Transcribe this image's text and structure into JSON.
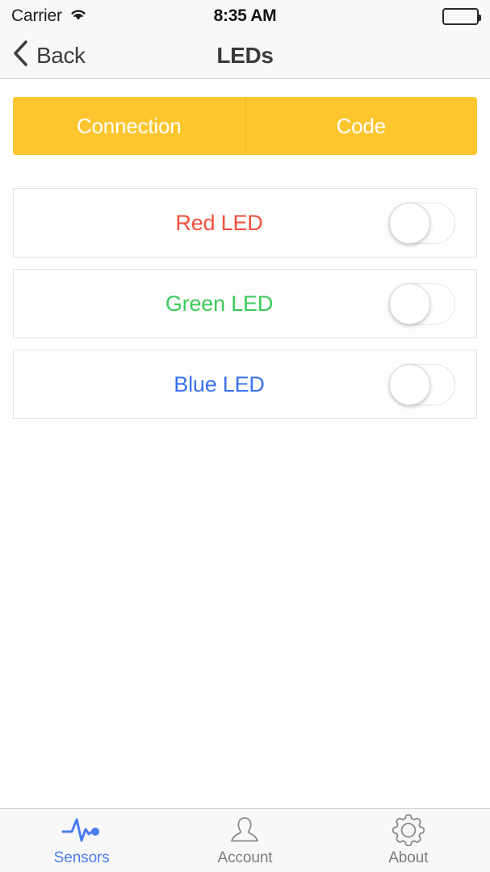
{
  "status_bar": {
    "carrier": "Carrier",
    "wifi_icon": "wifi-icon",
    "time": "8:35 AM",
    "battery_icon": "battery-full-icon"
  },
  "nav_bar": {
    "back_icon": "chevron-left-icon",
    "back_label": "Back",
    "title": "LEDs"
  },
  "segmented_control": {
    "segments": [
      {
        "label": "Connection",
        "selected": true
      },
      {
        "label": "Code",
        "selected": false
      }
    ],
    "background_color": "#FDC62F",
    "text_color": "#FFFFFF"
  },
  "led_list": {
    "rows": [
      {
        "label": "Red LED",
        "color": "#F4503C",
        "switch_state": "off",
        "switch_name": "red-led-toggle"
      },
      {
        "label": "Green LED",
        "color": "#3CCB5A",
        "switch_state": "off",
        "switch_name": "green-led-toggle"
      },
      {
        "label": "Blue LED",
        "color": "#3B72F0",
        "switch_state": "off",
        "switch_name": "blue-led-toggle"
      }
    ]
  },
  "tab_bar": {
    "active_color": "#4A7CF0",
    "inactive_color": "#7C7C7C",
    "tabs": [
      {
        "label": "Sensors",
        "icon": "pulse-wave-icon",
        "active": true
      },
      {
        "label": "Account",
        "icon": "person-icon",
        "active": false
      },
      {
        "label": "About",
        "icon": "gear-icon",
        "active": false
      }
    ]
  }
}
